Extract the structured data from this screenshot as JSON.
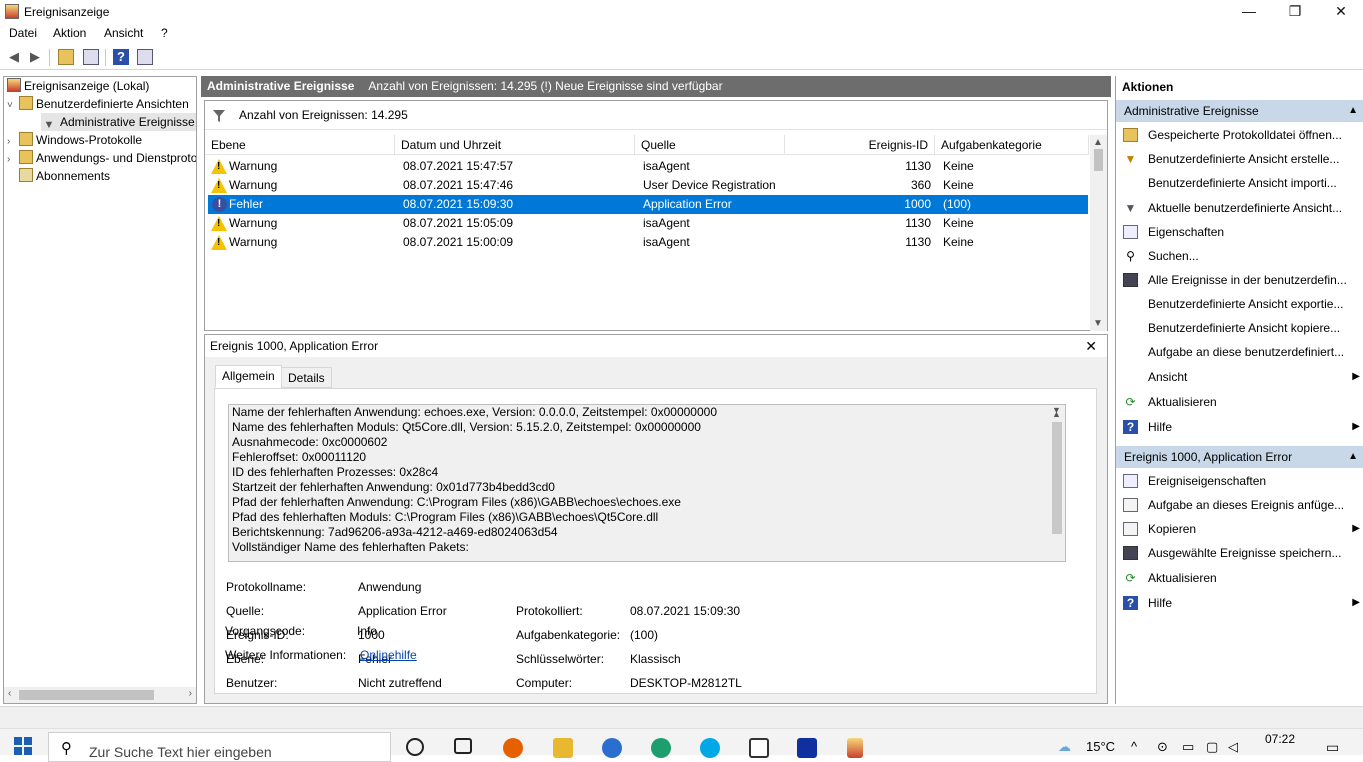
{
  "window": {
    "title": "Ereignisanzeige",
    "minimize": "—",
    "restore": "❐",
    "close": "✕"
  },
  "menu": [
    "Datei",
    "Aktion",
    "Ansicht",
    "?"
  ],
  "tree": {
    "root": "Ereignisanzeige (Lokal)",
    "custom_views": "Benutzerdefinierte Ansichten",
    "admin_events": "Administrative Ereignisse",
    "windows_logs": "Windows-Protokolle",
    "app_service_logs": "Anwendungs- und Dienstprotokolle",
    "subscriptions": "Abonnements"
  },
  "header": {
    "title": "Administrative Ereignisse",
    "info": "Anzahl von Ereignissen: 14.295 (!) Neue Ereignisse sind verfügbar"
  },
  "count_label": "Anzahl von Ereignissen: 14.295",
  "columns": {
    "level": "Ebene",
    "date": "Datum und Uhrzeit",
    "source": "Quelle",
    "event_id": "Ereignis-ID",
    "task": "Aufgabenkategorie"
  },
  "events": [
    {
      "level": "Warnung",
      "type": "warning",
      "date": "08.07.2021 15:47:57",
      "source": "isaAgent",
      "id": "1130",
      "task": "Keine"
    },
    {
      "level": "Warnung",
      "type": "warning",
      "date": "08.07.2021 15:47:46",
      "source": "User Device Registration",
      "id": "360",
      "task": "Keine"
    },
    {
      "level": "Fehler",
      "type": "error",
      "date": "08.07.2021 15:09:30",
      "source": "Application Error",
      "id": "1000",
      "task": "(100)"
    },
    {
      "level": "Warnung",
      "type": "warning",
      "date": "08.07.2021 15:05:09",
      "source": "isaAgent",
      "id": "1130",
      "task": "Keine"
    },
    {
      "level": "Warnung",
      "type": "warning",
      "date": "08.07.2021 15:00:09",
      "source": "isaAgent",
      "id": "1130",
      "task": "Keine"
    }
  ],
  "detail": {
    "title": "Ereignis 1000, Application Error",
    "tab_general": "Allgemein",
    "tab_details": "Details",
    "description": [
      "Name der fehlerhaften Anwendung: echoes.exe, Version: 0.0.0.0, Zeitstempel: 0x00000000",
      "Name des fehlerhaften Moduls: Qt5Core.dll, Version: 5.15.2.0, Zeitstempel: 0x00000000",
      "Ausnahmecode: 0xc0000602",
      "Fehleroffset: 0x00011120",
      "ID des fehlerhaften Prozesses: 0x28c4",
      "Startzeit der fehlerhaften Anwendung: 0x01d773b4bedd3cd0",
      "Pfad der fehlerhaften Anwendung: C:\\Program Files (x86)\\GABB\\echoes\\echoes.exe",
      "Pfad des fehlerhaften Moduls: C:\\Program Files (x86)\\GABB\\echoes\\Qt5Core.dll",
      "Berichtskennung: 7ad96206-a93a-4212-a469-ed8024063d54",
      "Vollständiger Name des fehlerhaften Pakets:"
    ],
    "log_name_label": "Protokollname:",
    "log_name": "Anwendung",
    "source_label": "Quelle:",
    "source": "Application Error",
    "logged_label": "Protokolliert:",
    "logged": "08.07.2021 15:09:30",
    "event_id_label": "Ereignis-ID:",
    "event_id": "1000",
    "task_label": "Aufgabenkategorie:",
    "task": "(100)",
    "level_label": "Ebene:",
    "level": "Fehler",
    "keywords_label": "Schlüsselwörter:",
    "keywords": "Klassisch",
    "user_label": "Benutzer:",
    "user": "Nicht zutreffend",
    "computer_label": "Computer:",
    "computer": "DESKTOP-M2812TL",
    "opcode_label": "Vorgangscode:",
    "opcode": "Info",
    "more_info_label": "Weitere Informationen:",
    "more_info_link": "Onlinehilfe"
  },
  "actions": {
    "title": "Aktionen",
    "section1": "Administrative Ereignisse",
    "items1": [
      "Gespeicherte Protokolldatei öffnen...",
      "Benutzerdefinierte Ansicht erstelle...",
      "Benutzerdefinierte Ansicht importi...",
      "Aktuelle benutzerdefinierte Ansicht...",
      "Eigenschaften",
      "Suchen...",
      "Alle Ereignisse in der benutzerdefin...",
      "Benutzerdefinierte Ansicht exportie...",
      "Benutzerdefinierte Ansicht kopiere...",
      "Aufgabe an diese benutzerdefiniert...",
      "Ansicht",
      "Aktualisieren",
      "Hilfe"
    ],
    "section2": "Ereignis 1000, Application Error",
    "items2": [
      "Ereigniseigenschaften",
      "Aufgabe an dieses Ereignis anfüge...",
      "Kopieren",
      "Ausgewählte Ereignisse speichern...",
      "Aktualisieren",
      "Hilfe"
    ]
  },
  "taskbar": {
    "search_placeholder": "Zur Suche Text hier eingeben",
    "temperature": "15°C",
    "time": "07:22"
  }
}
